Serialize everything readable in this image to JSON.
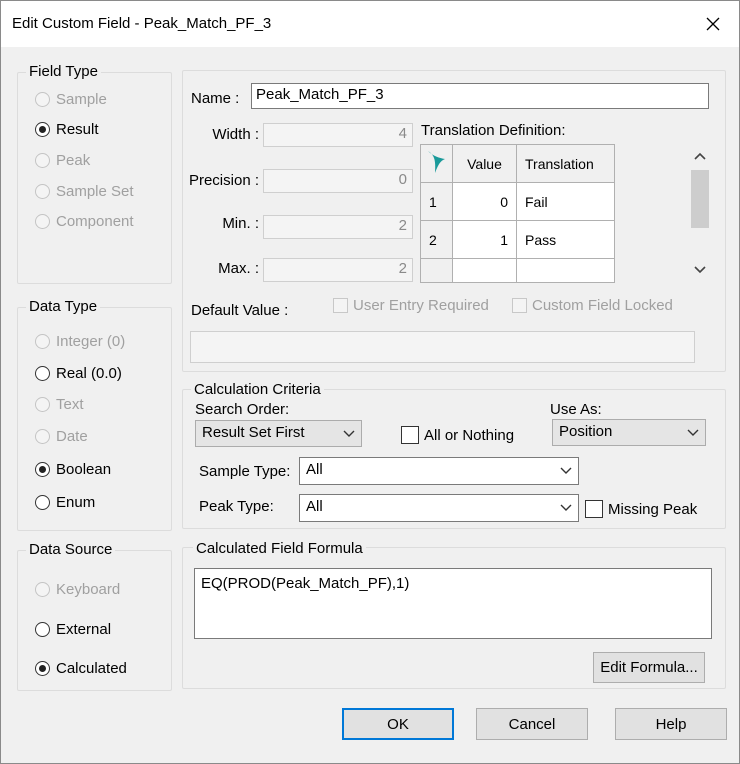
{
  "window": {
    "title": "Edit Custom Field - Peak_Match_PF_3"
  },
  "field_type": {
    "label": "Field Type",
    "options": [
      {
        "label": "Sample",
        "enabled": false,
        "selected": false
      },
      {
        "label": "Result",
        "enabled": true,
        "selected": true
      },
      {
        "label": "Peak",
        "enabled": false,
        "selected": false
      },
      {
        "label": "Sample Set",
        "enabled": false,
        "selected": false
      },
      {
        "label": "Component",
        "enabled": false,
        "selected": false
      }
    ]
  },
  "data_type": {
    "label": "Data Type",
    "options": [
      {
        "label": "Integer (0)",
        "enabled": false,
        "selected": false
      },
      {
        "label": "Real (0.0)",
        "enabled": true,
        "selected": false
      },
      {
        "label": "Text",
        "enabled": false,
        "selected": false
      },
      {
        "label": "Date",
        "enabled": false,
        "selected": false
      },
      {
        "label": "Boolean",
        "enabled": true,
        "selected": true
      },
      {
        "label": "Enum",
        "enabled": true,
        "selected": false
      }
    ]
  },
  "data_source": {
    "label": "Data Source",
    "options": [
      {
        "label": "Keyboard",
        "enabled": false,
        "selected": false
      },
      {
        "label": "External",
        "enabled": true,
        "selected": false
      },
      {
        "label": "Calculated",
        "enabled": true,
        "selected": true
      }
    ]
  },
  "properties": {
    "name_label": "Name :",
    "name_value": "Peak_Match_PF_3",
    "width_label": "Width :",
    "width_value": "4",
    "precision_label": "Precision :",
    "precision_value": "0",
    "min_label": "Min. :",
    "min_value": "2",
    "max_label": "Max. :",
    "max_value": "2",
    "default_value_label": "Default Value :",
    "user_entry_required": "User Entry Required",
    "custom_field_locked": "Custom Field Locked"
  },
  "translation": {
    "label": "Translation Definition:",
    "headers": {
      "value": "Value",
      "translation": "Translation"
    },
    "rows": [
      {
        "index": "1",
        "value": "0",
        "translation": "Fail"
      },
      {
        "index": "2",
        "value": "1",
        "translation": "Pass"
      }
    ]
  },
  "calc": {
    "label": "Calculation Criteria",
    "search_order_label": "Search Order:",
    "search_order_value": "Result Set First",
    "all_or_nothing": "All or Nothing",
    "use_as_label": "Use As:",
    "use_as_value": "Position",
    "sample_type_label": "Sample Type:",
    "sample_type_value": "All",
    "peak_type_label": "Peak Type:",
    "peak_type_value": "All",
    "missing_peak": "Missing Peak"
  },
  "formula": {
    "label": "Calculated Field Formula",
    "value": "EQ(PROD(Peak_Match_PF),1)",
    "edit_button": "Edit Formula..."
  },
  "buttons": {
    "ok": "OK",
    "cancel": "Cancel",
    "help": "Help"
  },
  "colors": {
    "accent": "#0078d7",
    "icon_teal": "#1a9a9a"
  }
}
